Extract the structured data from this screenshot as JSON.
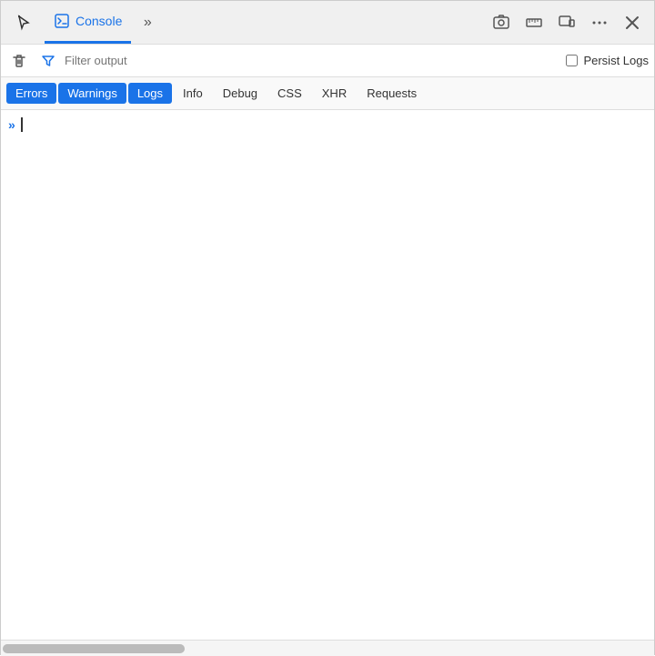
{
  "topToolbar": {
    "cursorIcon": "↖",
    "consoleTab": {
      "label": "Console",
      "icon": "console"
    },
    "moreTabsLabel": "»",
    "icons": {
      "screenshot": "📷",
      "ruler": "📏",
      "responsive": "⊡",
      "more": "···",
      "close": "✕"
    }
  },
  "filterBar": {
    "clearLabel": "🗑",
    "filterIcon": "⬡",
    "placeholder": "Filter output",
    "persistLogsLabel": "Persist Logs"
  },
  "levelTabs": [
    {
      "id": "errors",
      "label": "Errors",
      "active": true
    },
    {
      "id": "warnings",
      "label": "Warnings",
      "active": true
    },
    {
      "id": "logs",
      "label": "Logs",
      "active": true
    },
    {
      "id": "info",
      "label": "Info",
      "active": false
    },
    {
      "id": "debug",
      "label": "Debug",
      "active": false
    },
    {
      "id": "css",
      "label": "CSS",
      "active": false
    },
    {
      "id": "xhr",
      "label": "XHR",
      "active": false
    },
    {
      "id": "requests",
      "label": "Requests",
      "active": false
    }
  ],
  "console": {
    "promptArrows": "»",
    "outputEmpty": true
  }
}
